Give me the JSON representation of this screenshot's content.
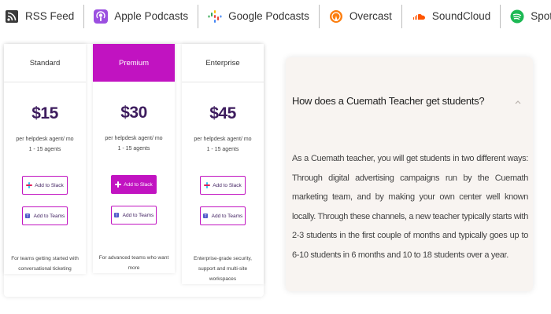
{
  "podcast_links": [
    {
      "label": "RSS Feed",
      "icon": "rss-icon"
    },
    {
      "label": "Apple Podcasts",
      "icon": "apple-podcasts-icon"
    },
    {
      "label": "Google Podcasts",
      "icon": "google-podcasts-icon"
    },
    {
      "label": "Overcast",
      "icon": "overcast-icon"
    },
    {
      "label": "SoundCloud",
      "icon": "soundcloud-icon"
    },
    {
      "label": "Spotify",
      "icon": "spotify-icon"
    }
  ],
  "plans": [
    {
      "name": "Standard",
      "price": "$15",
      "price_line": "per helpdesk agent/ mo",
      "agents": "1 - 15 agents",
      "slack_label": "Add to Slack",
      "teams_label": "Add to Teams",
      "description": "For teams getting started with conversational ticketing"
    },
    {
      "name": "Premium",
      "price": "$30",
      "price_line": "per helpdesk agent/ mo",
      "agents": "1 - 15 agents",
      "slack_label": "Add to Slack",
      "teams_label": "Add to Teams",
      "description": "For advanced teams who want more"
    },
    {
      "name": "Enterprise",
      "price": "$45",
      "price_line": "per helpdesk agent/ mo",
      "agents": "1 - 15 agents",
      "slack_label": "Add to Slack",
      "teams_label": "Add to Teams",
      "description": "Enterprise-grade security, support and multi-site workspaces"
    }
  ],
  "faq": {
    "question": "How does a Cuemath Teacher get students?",
    "answer": "As a Cuemath teacher, you will get students in two different ways: Through digital advertising campaigns run by the Cuemath marketing team, and by making your own center well known locally. Through these channels, a new teacher typically starts with 2-3 students in the first couple of months and typically goes up to 6-10 students in 6 months and 10 to 18 students over a year."
  },
  "colors": {
    "accent": "#c113c1",
    "price_text": "#3d1c5e"
  }
}
